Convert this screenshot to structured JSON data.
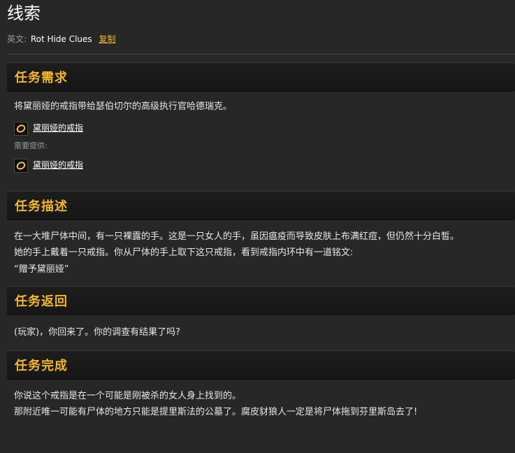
{
  "page": {
    "title": "线索",
    "english_label": "英文:",
    "english_name": "Rot Hide Clues",
    "copy_label": "复制"
  },
  "sections": {
    "requirements": {
      "title": "任务需求",
      "text": "将黛丽娅的戒指带给瑟伯切尔的高级执行官哈德瑞克。",
      "item_name": "黛丽娅的戒指",
      "provide_label": "需要提供:",
      "provided_item_name": "黛丽娅的戒指"
    },
    "description": {
      "title": "任务描述",
      "lines": [
        "在一大堆尸体中间，有一只裸露的手。这是一只女人的手，虽因瘟疫而导致皮肤上布满红痘，但仍然十分白皙。",
        "她的手上戴着一只戒指。你从尸体的手上取下这只戒指，看到戒指内环中有一道铭文:",
        "“赠予黛丽娅”"
      ]
    },
    "return": {
      "title": "任务返回",
      "text": "(玩家)，你回来了。你的调查有结果了吗?"
    },
    "completion": {
      "title": "任务完成",
      "lines": [
        "你说这个戒指是在一个可能是刚被杀的女人身上找到的。",
        "那附近唯一可能有尸体的地方只能是提里斯法的公墓了。腐皮豺狼人一定是将尸体拖到芬里斯岛去了!"
      ]
    }
  },
  "colors": {
    "accent": "#f3b62a",
    "link": "#f0b428",
    "background": "#272727",
    "header_bg": "#1a1a1a"
  },
  "icons": {
    "item": "ring-icon"
  }
}
